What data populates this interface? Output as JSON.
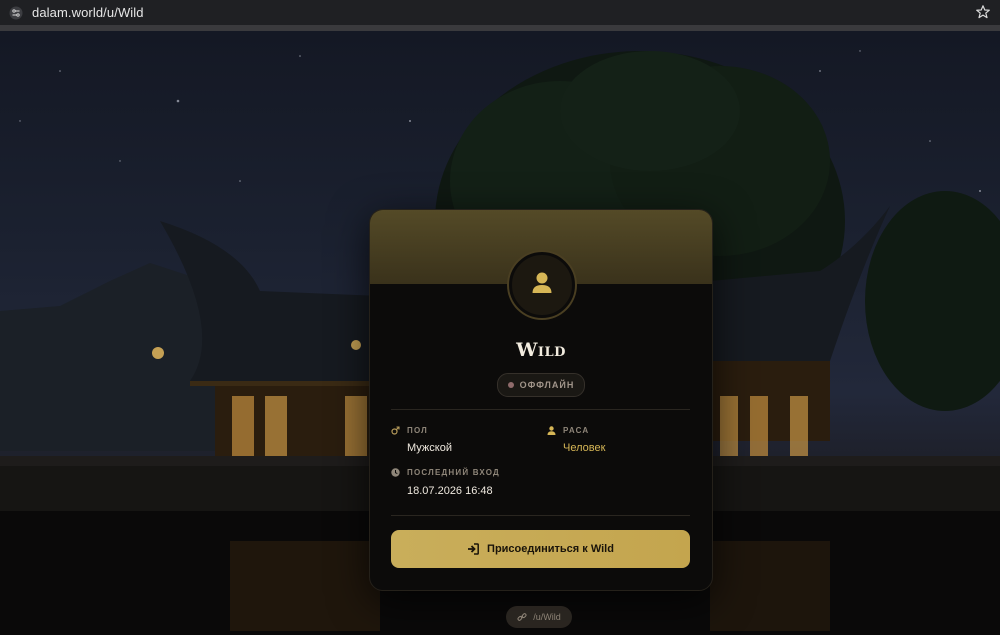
{
  "browser": {
    "url": "dalam.world/u/Wild"
  },
  "profile": {
    "username": "Wild",
    "status": "ОФФЛАЙН",
    "fields": {
      "gender_label": "ПОЛ",
      "gender_value": "Мужской",
      "race_label": "РАСА",
      "race_value": "Человек",
      "last_login_label": "ПОСЛЕДНИЙ ВХОД",
      "last_login_value": "18.07.2026 16:48"
    },
    "join_button": "Присоединиться к Wild",
    "profile_link": "/u/Wild"
  },
  "colors": {
    "accent": "#c9ae5b",
    "accent_text": "#d6b656",
    "card_bg": "#0c0b0a",
    "status_dot": "#8f6b6b"
  },
  "icons": {
    "site": "tune-icon",
    "bookmark": "star-icon",
    "avatar": "user-icon",
    "gender": "male-icon",
    "race": "person-icon",
    "last_login": "clock-icon",
    "join": "sign-in-icon",
    "link": "link-icon"
  }
}
